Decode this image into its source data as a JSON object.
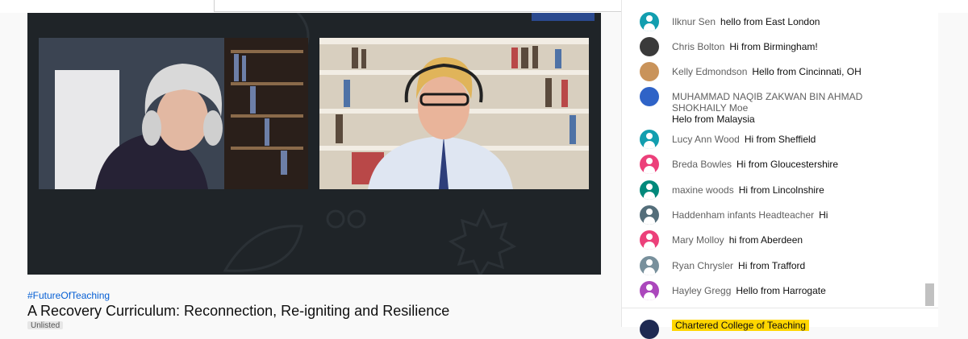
{
  "video": {
    "hashtag": "#FutureOfTeaching",
    "title": "A Recovery Curriculum: Reconnection, Re-igniting and Resilience",
    "visibility_badge": "Unlisted"
  },
  "chat": {
    "messages": [
      {
        "author": "Ilknur Sen",
        "text": "hello from East London",
        "avatar_color": "#129eaf"
      },
      {
        "author": "Chris Bolton",
        "text": "Hi from Birmingham!",
        "avatar_color": "#3a3a3a"
      },
      {
        "author": "Kelly Edmondson",
        "text": "Hello from Cincinnati, OH",
        "avatar_color": "#c9935a"
      },
      {
        "author": "MUHAMMAD NAQIB ZAKWAN BIN AHMAD SHOKHAILY Moe",
        "text": "Helo from Malaysia",
        "avatar_color": "#2f63c7"
      },
      {
        "author": "Lucy Ann Wood",
        "text": "Hi from Sheffield",
        "avatar_color": "#129eaf"
      },
      {
        "author": "Breda Bowles",
        "text": "Hi from Gloucestershire",
        "avatar_color": "#ec407a"
      },
      {
        "author": "maxine woods",
        "text": "Hi from Lincolnshire",
        "avatar_color": "#00897b"
      },
      {
        "author": "Haddenham infants Headteacher",
        "text": "Hi",
        "avatar_color": "#546e7a"
      },
      {
        "author": "Mary Molloy",
        "text": "hi from Aberdeen",
        "avatar_color": "#ec407a"
      },
      {
        "author": "Ryan Chrysler",
        "text": "Hi from Trafford",
        "avatar_color": "#78909c"
      },
      {
        "author": "Hayley Gregg",
        "text": "Hello from Harrogate",
        "avatar_color": "#ab47bc"
      }
    ],
    "owner": {
      "name": "Chartered College of Teaching"
    }
  }
}
